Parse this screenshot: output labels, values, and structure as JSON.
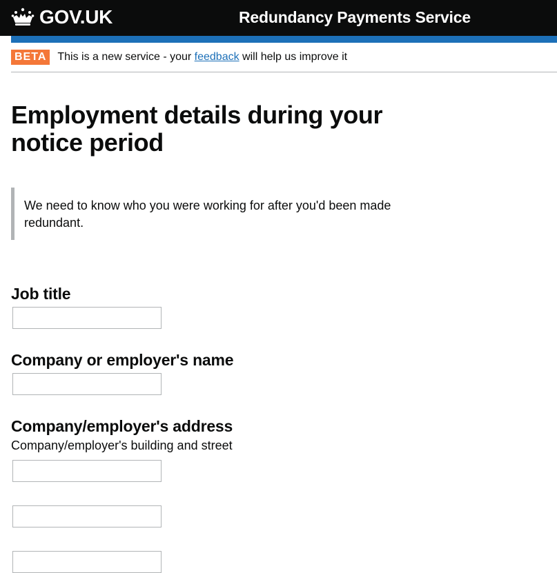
{
  "header": {
    "logo_text": "GOV.UK",
    "service_name": "Redundancy Payments Service",
    "icon": "crown-icon"
  },
  "phase_banner": {
    "tag": "BETA",
    "text_before": "This is a new service - your ",
    "link_text": "feedback",
    "text_after": " will help us improve it"
  },
  "page": {
    "title": "Employment details during your notice period",
    "inset_text": "We need to know who you were working for after you'd been made redundant."
  },
  "form": {
    "job_title": {
      "label": "Job title",
      "value": ""
    },
    "employer_name": {
      "label": "Company or employer's name",
      "value": ""
    },
    "employer_address": {
      "label": "Company/employer's address",
      "hint": "Company/employer's building and street",
      "line1": "",
      "line2": "",
      "line3": ""
    }
  },
  "colors": {
    "header_bg": "#0b0c0c",
    "brand_blue": "#1d70b8",
    "beta_tag": "#f47738",
    "link": "#1d70b8",
    "border_grey": "#b1b4b6"
  }
}
